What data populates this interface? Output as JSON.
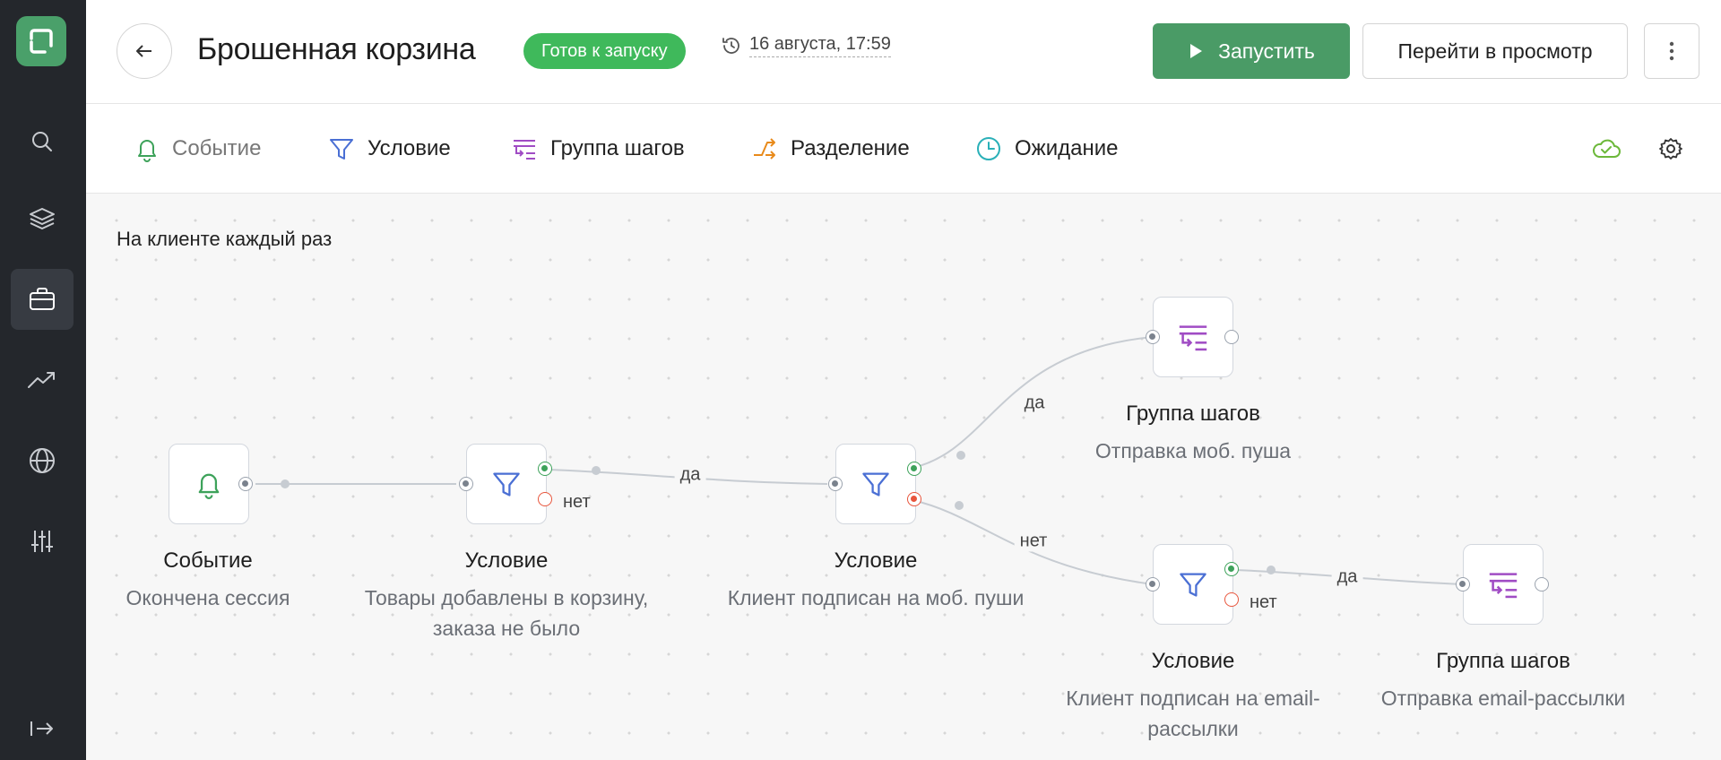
{
  "header": {
    "title": "Брошенная корзина",
    "status": "Готов к запуску",
    "saved_at": "16 августа, 17:59",
    "run_label": "Запустить",
    "preview_label": "Перейти в просмотр"
  },
  "sidebar": {
    "items": [
      "search-icon",
      "layers-icon",
      "briefcase-icon",
      "trend-icon",
      "globe-icon",
      "sliders-icon"
    ],
    "active": "briefcase-icon",
    "collapse_icon": "collapse-icon"
  },
  "toolbar": {
    "items": [
      {
        "label": "Событие",
        "icon": "bell-icon",
        "color": "#3da25a"
      },
      {
        "label": "Условие",
        "icon": "filter-icon",
        "color": "#4a6fd4"
      },
      {
        "label": "Группа шагов",
        "icon": "step-group-icon",
        "color": "#a04cc4"
      },
      {
        "label": "Разделение",
        "icon": "split-icon",
        "color": "#e88a1a"
      },
      {
        "label": "Ожидание",
        "icon": "clock-icon",
        "color": "#2ab0b8"
      }
    ]
  },
  "canvas": {
    "trigger_label": "На клиенте каждый раз",
    "nodes": [
      {
        "title": "Событие",
        "subtitle": "Окончена сессия"
      },
      {
        "title": "Условие",
        "subtitle_lines": [
          "Товары добавлены в корзину,",
          "заказа не было"
        ],
        "no_label": "нет"
      },
      {
        "title": "Условие",
        "subtitle": "Клиент подписан на моб. пуши"
      },
      {
        "title": "Группа шагов",
        "subtitle": "Отправка моб. пуша"
      },
      {
        "title": "Условие",
        "subtitle_lines": [
          "Клиент подписан на email-",
          "рассылки"
        ],
        "no_label": "нет"
      },
      {
        "title": "Группа шагов",
        "subtitle": "Отправка email-рассылки"
      }
    ],
    "edge_labels": {
      "yes": "да",
      "no": "нет"
    }
  },
  "colors": {
    "accent": "#4a9b66",
    "status": "#3fb95b",
    "sidebar": "#24272c",
    "yes": "#3da25a",
    "no": "#e8553c"
  }
}
